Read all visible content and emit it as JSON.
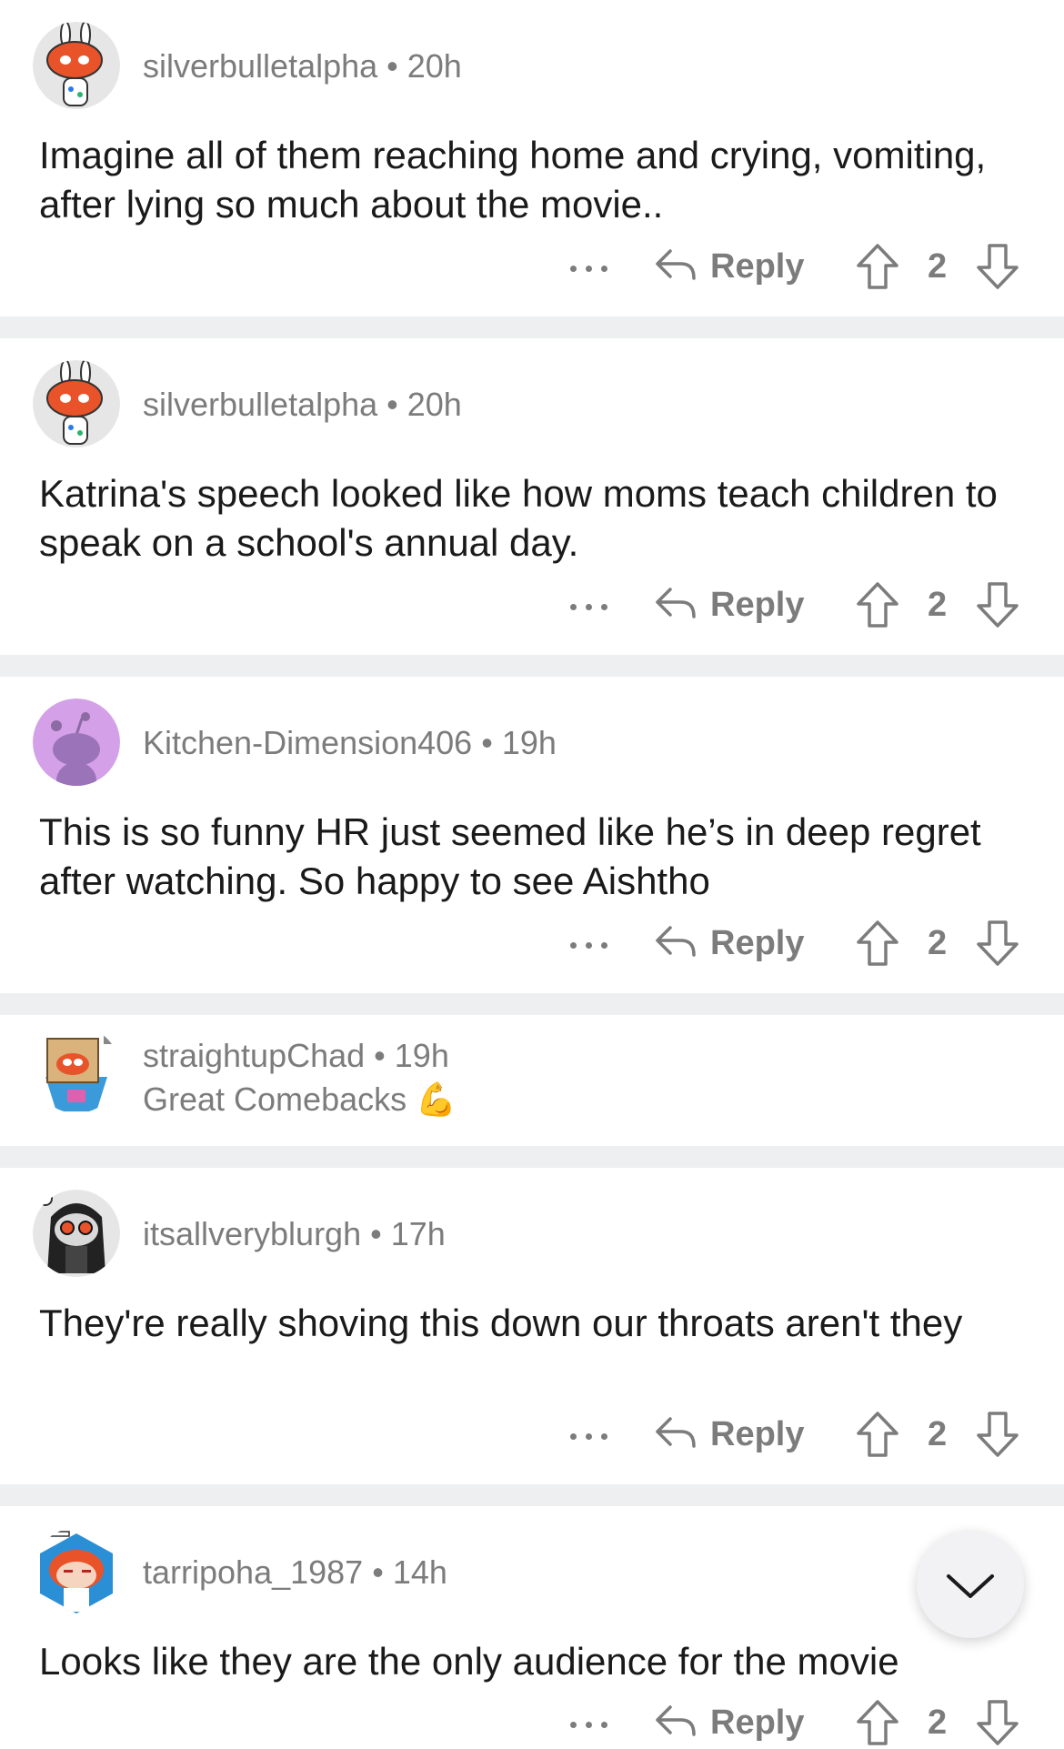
{
  "comments": [
    {
      "username": "silverbulletalpha",
      "age": "20h",
      "avatar": "bunny-ears-snoo-avatar",
      "text": "Imagine all of them reaching home and crying, vomiting, after lying so much about the movie..",
      "reply_label": "Reply",
      "score": "2"
    },
    {
      "username": "silverbulletalpha",
      "age": "20h",
      "avatar": "bunny-ears-snoo-avatar",
      "text": "Katrina's speech looked like how moms teach children to speak on a school's annual day.",
      "reply_label": "Reply",
      "score": "2"
    },
    {
      "username": "Kitchen-Dimension406",
      "age": "19h",
      "avatar": "default-purple-snoo-avatar",
      "text": "This is so funny HR just seemed like he’s in deep regret after watching. So happy to see Aishtho",
      "reply_label": "Reply",
      "score": "2"
    },
    {
      "username": "straightupChad",
      "age": "19h",
      "avatar": "box-head-snoo-avatar",
      "flair": "Great Comebacks",
      "flair_emoji": "💪"
    },
    {
      "username": "itsallveryblurgh",
      "age": "17h",
      "avatar": "sunglasses-snoo-avatar",
      "text": "They're really shoving this down our throats aren't they",
      "reply_label": "Reply",
      "score": "2"
    },
    {
      "username": "tarripoha_1987",
      "age": "14h",
      "avatar": "orange-hair-snoo-avatar",
      "text": "Looks like they are the only audience for the movie",
      "reply_label": "Reply",
      "score": "2"
    }
  ],
  "colors": {
    "meta_text": "#7c7c7c",
    "body_text": "#1a1a1b",
    "divider": "#edeff1",
    "purple_avatar": "#d4a0e8"
  },
  "icons": {
    "more": "more-options-icon",
    "reply": "reply-arrow-icon",
    "upvote": "upvote-arrow-icon",
    "downvote": "downvote-arrow-icon",
    "scroll": "chevron-down-icon"
  }
}
